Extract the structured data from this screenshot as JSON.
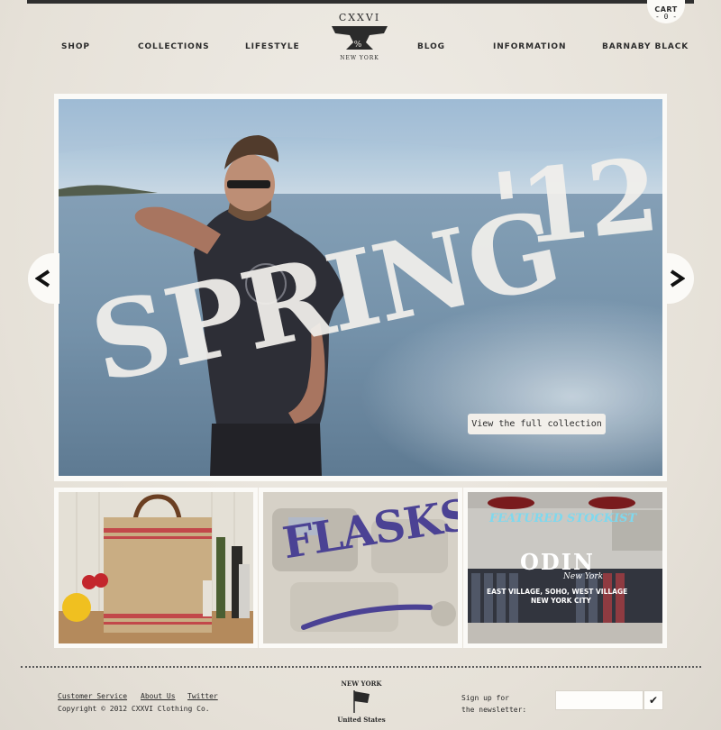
{
  "cart": {
    "label": "CART",
    "count": "- 0 -"
  },
  "nav": {
    "shop": "SHOP",
    "collections": "COLLECTIONS",
    "lifestyle": "LIFESTYLE",
    "blog": "BLOG",
    "information": "INFORMATION",
    "barnaby_black": "BARNABY BLACK"
  },
  "logo": {
    "brand": "CXXVI",
    "city": "NEW YORK",
    "mark": "%"
  },
  "hero": {
    "headline_word": "SPRING",
    "headline_year": "'12",
    "cta": "View the full collection",
    "prev_arrow": "chevron-left-icon",
    "next_arrow": "chevron-right-icon"
  },
  "tiles": {
    "flasks": {
      "title": "FLASKS!"
    },
    "stockist": {
      "heading": "FEATURED STOCKIST",
      "store": "ODIN",
      "store_city": "New York",
      "locations": "EAST VILLAGE, SOHO, WEST VILLAGE",
      "region": "NEW YORK CITY"
    }
  },
  "footer": {
    "links": [
      "Customer Service",
      "About Us",
      "Twitter"
    ],
    "copyright": "Copyright © 2012 CXXVI Clothing Co.",
    "badge_top": "NEW YORK",
    "badge_bottom": "United States",
    "signup_line1": "Sign up for",
    "signup_line2": "the newsletter:",
    "submit_icon": "checkmark-icon",
    "submit_glyph": "✔",
    "email_placeholder": ""
  },
  "colors": {
    "bar": "#2f2f2f",
    "frame": "#fbfaf7",
    "page_bg": "#ebe7e0",
    "stockist_heading": "#7ed8ee",
    "flasks_text": "#4b4294"
  }
}
